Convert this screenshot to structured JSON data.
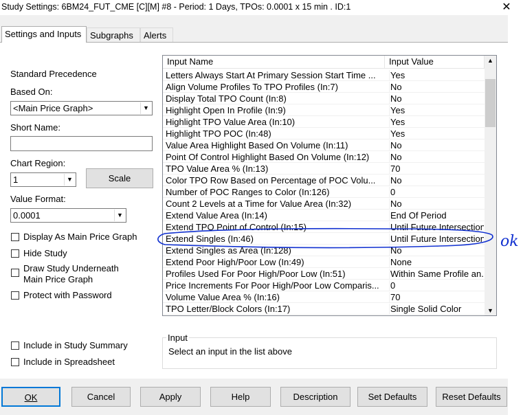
{
  "window": {
    "title": "Study Settings: 6BM24_FUT_CME [C][M] #8 - Period: 1 Days, TPOs: 0.0001 x 15 min  . ID:1",
    "close": "✕"
  },
  "tabs": [
    "Settings and Inputs",
    "Subgraphs",
    "Alerts"
  ],
  "left": {
    "standard_precedence": "Standard Precedence",
    "based_on_label": "Based On:",
    "based_on_value": "<Main Price Graph>",
    "short_name_label": "Short Name:",
    "short_name_value": "",
    "chart_region_label": "Chart Region:",
    "chart_region_value": "1",
    "scale_button": "Scale",
    "value_format_label": "Value Format:",
    "value_format_value": "0.0001",
    "checkboxes": [
      "Display As Main Price Graph",
      "Hide Study",
      "Draw Study Underneath Main Price Graph",
      "Protect with Password",
      "Include in Study Summary",
      "Include in Spreadsheet"
    ]
  },
  "inputs_list": {
    "headers": [
      "Input Name",
      "Input Value"
    ],
    "rows": [
      [
        "Letters Always Start At Primary Session Start Time   ...",
        "Yes"
      ],
      [
        "Align Volume Profiles To TPO Profiles   (In:7)",
        "No"
      ],
      [
        "Display Total TPO Count   (In:8)",
        "No"
      ],
      [
        "Highlight Open In Profile   (In:9)",
        "Yes"
      ],
      [
        "Highlight TPO Value Area   (In:10)",
        "Yes"
      ],
      [
        "Highlight TPO POC   (In:48)",
        "Yes"
      ],
      [
        "Value Area Highlight Based On Volume   (In:11)",
        "No"
      ],
      [
        "Point Of Control Highlight Based On Volume   (In:12)",
        "No"
      ],
      [
        "TPO Value Area %   (In:13)",
        "70"
      ],
      [
        "Color TPO Row Based on Percentage of POC Volu...",
        "No"
      ],
      [
        "Number of POC Ranges to Color   (In:126)",
        "0"
      ],
      [
        "Count 2 Levels at a Time for Value Area   (In:32)",
        "No"
      ],
      [
        "Extend Value Area   (In:14)",
        "End Of Period"
      ],
      [
        "Extend TPO Point of Control   (In:15)",
        "Until Future Intersection"
      ],
      [
        "Extend Singles   (In:46)",
        "Until Future Intersection"
      ],
      [
        "Extend Singles as Area   (In:128)",
        "No"
      ],
      [
        "Extend Poor High/Poor Low   (In:49)",
        "None"
      ],
      [
        "Profiles Used For Poor High/Poor Low   (In:51)",
        "Within Same Profile an..."
      ],
      [
        "Price Increments For Poor High/Poor Low Comparis...",
        "0"
      ],
      [
        "Volume Value Area %   (In:16)",
        "70"
      ],
      [
        "TPO Letter/Block Colors   (In:17)",
        "Single Solid Color"
      ]
    ]
  },
  "input_group": {
    "title": "Input",
    "text": "Select an input in the list above"
  },
  "buttons": [
    "OK",
    "Cancel",
    "Apply",
    "Help",
    "Description",
    "Set Defaults",
    "Reset Defaults"
  ],
  "annotation": {
    "text": "ok",
    "color": "#1030d0"
  }
}
